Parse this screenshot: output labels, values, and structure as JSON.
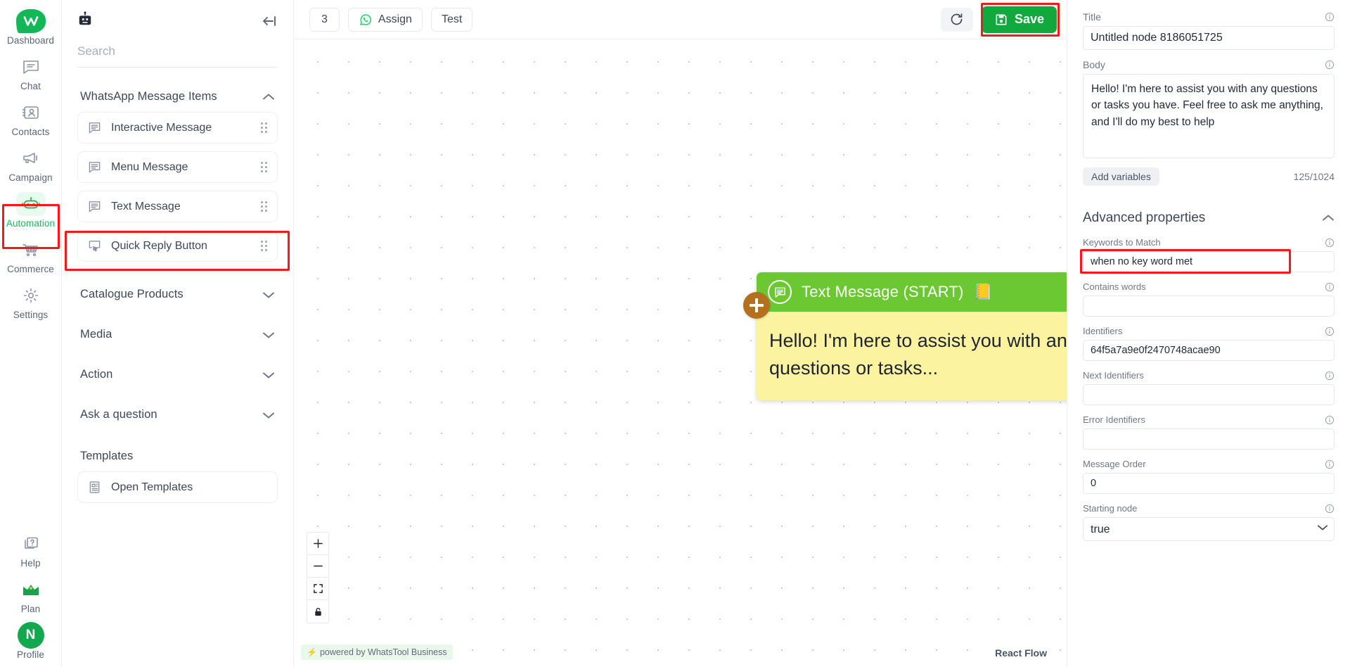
{
  "rail": {
    "items": [
      {
        "label": "Dashboard",
        "icon": "whatstool-logo-icon",
        "active": false
      },
      {
        "label": "Chat",
        "icon": "chat-bubble-icon",
        "active": false
      },
      {
        "label": "Contacts",
        "icon": "contacts-card-icon",
        "active": false
      },
      {
        "label": "Campaign",
        "icon": "megaphone-icon",
        "active": false
      },
      {
        "label": "Automation",
        "icon": "robot-icon",
        "active": true
      },
      {
        "label": "Commerce",
        "icon": "shopping-cart-icon",
        "active": false
      },
      {
        "label": "Settings",
        "icon": "gear-icon",
        "active": false
      }
    ],
    "bottom": [
      {
        "label": "Help",
        "icon": "help-question-icon"
      },
      {
        "label": "Plan",
        "icon": "crown-icon"
      },
      {
        "label": "Profile",
        "icon": "avatar-icon",
        "avatar_letter": "N"
      }
    ]
  },
  "library": {
    "bot_icon": "robot-icon",
    "collapse_icon": "collapse-panel-icon",
    "search": {
      "value": "",
      "placeholder": "Search"
    },
    "sections": [
      {
        "title": "WhatsApp Message Items",
        "expanded": true,
        "chevron": "chevron-up-icon",
        "items": [
          {
            "label": "Interactive Message",
            "icon": "message-lines-icon",
            "highlighted": false
          },
          {
            "label": "Menu Message",
            "icon": "message-lines-icon",
            "highlighted": false
          },
          {
            "label": "Text Message",
            "icon": "message-lines-icon",
            "highlighted": true
          },
          {
            "label": "Quick Reply Button",
            "icon": "quick-reply-icon",
            "highlighted": false
          }
        ]
      },
      {
        "title": "Catalogue Products",
        "expanded": false,
        "chevron": "chevron-down-icon",
        "items": []
      },
      {
        "title": "Media",
        "expanded": false,
        "chevron": "chevron-down-icon",
        "items": []
      },
      {
        "title": "Action",
        "expanded": false,
        "chevron": "chevron-down-icon",
        "items": []
      },
      {
        "title": "Ask a question",
        "expanded": false,
        "chevron": "chevron-down-icon",
        "items": []
      }
    ],
    "templates": {
      "title": "Templates",
      "items": [
        {
          "label": "Open Templates",
          "icon": "document-template-icon"
        }
      ]
    }
  },
  "toolbar": {
    "count_label": "3",
    "assign_label": "Assign",
    "assign_icon": "whatsapp-icon",
    "test_label": "Test",
    "refresh_icon": "refresh-icon",
    "save_label": "Save",
    "save_icon": "floppy-disk-icon",
    "save_color": "#11a93e"
  },
  "canvas": {
    "node": {
      "title": "Text Message (START)",
      "header_icon": "message-lines-icon",
      "badge_emoji": "📒",
      "menu_icon": "vertical-dots-icon",
      "body_text": "Hello! I'm here to assist you with any questions or tasks...",
      "header_color": "#6cc832",
      "body_color": "#fbf3a0",
      "left_handle_icon": "add-node-left-icon",
      "left_handle_color": "#b5701f",
      "right_handle_icon": "add-node-right-icon",
      "right_handle_color": "#0aa33f"
    },
    "controls": [
      {
        "name": "zoom-in",
        "icon": "plus-icon"
      },
      {
        "name": "zoom-out",
        "icon": "minus-icon"
      },
      {
        "name": "fit-view",
        "icon": "fit-screen-icon"
      },
      {
        "name": "toggle-interactivity",
        "icon": "lock-icon"
      }
    ],
    "powered_by": "powered by WhatsTool Business",
    "attribution": "React Flow"
  },
  "properties": {
    "title_field": {
      "label": "Title",
      "value": "Untitled node 8186051725",
      "info_icon": "info-icon"
    },
    "body_field": {
      "label": "Body",
      "value": "Hello! I'm here to assist you with any questions or tasks you have. Feel free to ask me anything, and I'll do my best to help",
      "info_icon": "info-icon",
      "add_variables_label": "Add variables",
      "counter": "125/1024"
    },
    "advanced": {
      "title": "Advanced properties",
      "expanded": true,
      "chevron": "chevron-up-icon",
      "fields": [
        {
          "label": "Keywords to Match",
          "value": "when no key word met",
          "type": "text",
          "highlighted": true
        },
        {
          "label": "Contains words",
          "value": "",
          "type": "text",
          "highlighted": false
        },
        {
          "label": "Identifiers",
          "value": "64f5a7a9e0f2470748acae90",
          "type": "text",
          "highlighted": false
        },
        {
          "label": "Next Identifiers",
          "value": "",
          "type": "text",
          "highlighted": false
        },
        {
          "label": "Error Identifiers",
          "value": "",
          "type": "text",
          "highlighted": false
        },
        {
          "label": "Message Order",
          "value": "0",
          "type": "text",
          "highlighted": false
        },
        {
          "label": "Starting node",
          "value": "true",
          "type": "select",
          "options": [
            "true",
            "false"
          ],
          "highlighted": false
        }
      ]
    }
  },
  "highlights": {
    "color": "#f5191b"
  }
}
